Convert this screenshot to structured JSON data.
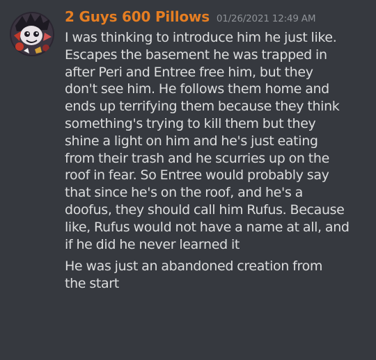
{
  "colors": {
    "background": "#36393f",
    "username": "#e67e22",
    "timestamp": "#8e9297",
    "text": "#dcddde"
  },
  "message": {
    "author": "2 Guys 600 Pillows",
    "timestamp": "01/26/2021 12:49 AM",
    "avatar_icon": "user-avatar-icon",
    "paragraphs": [
      {
        "lines": [
          "I was thinking to introduce him he just like.",
          "Escapes the basement he was trapped in",
          "after Peri and Entree free him, but they",
          "don't see him. He follows them home and",
          "ends up terrifying them because they think",
          "something's trying to kill them but they",
          "shine a light on him and he's just eating",
          "from their trash and he scurries up on the",
          "roof in fear. So Entree would probably say",
          "that since he's on the roof, and he's a",
          "doofus, they should call him Rufus. Because",
          "like, Rufus would not have a name at all, and",
          "if he did he never learned it"
        ]
      },
      {
        "lines": [
          "He was just an abandoned creation from",
          "the start"
        ]
      }
    ]
  }
}
